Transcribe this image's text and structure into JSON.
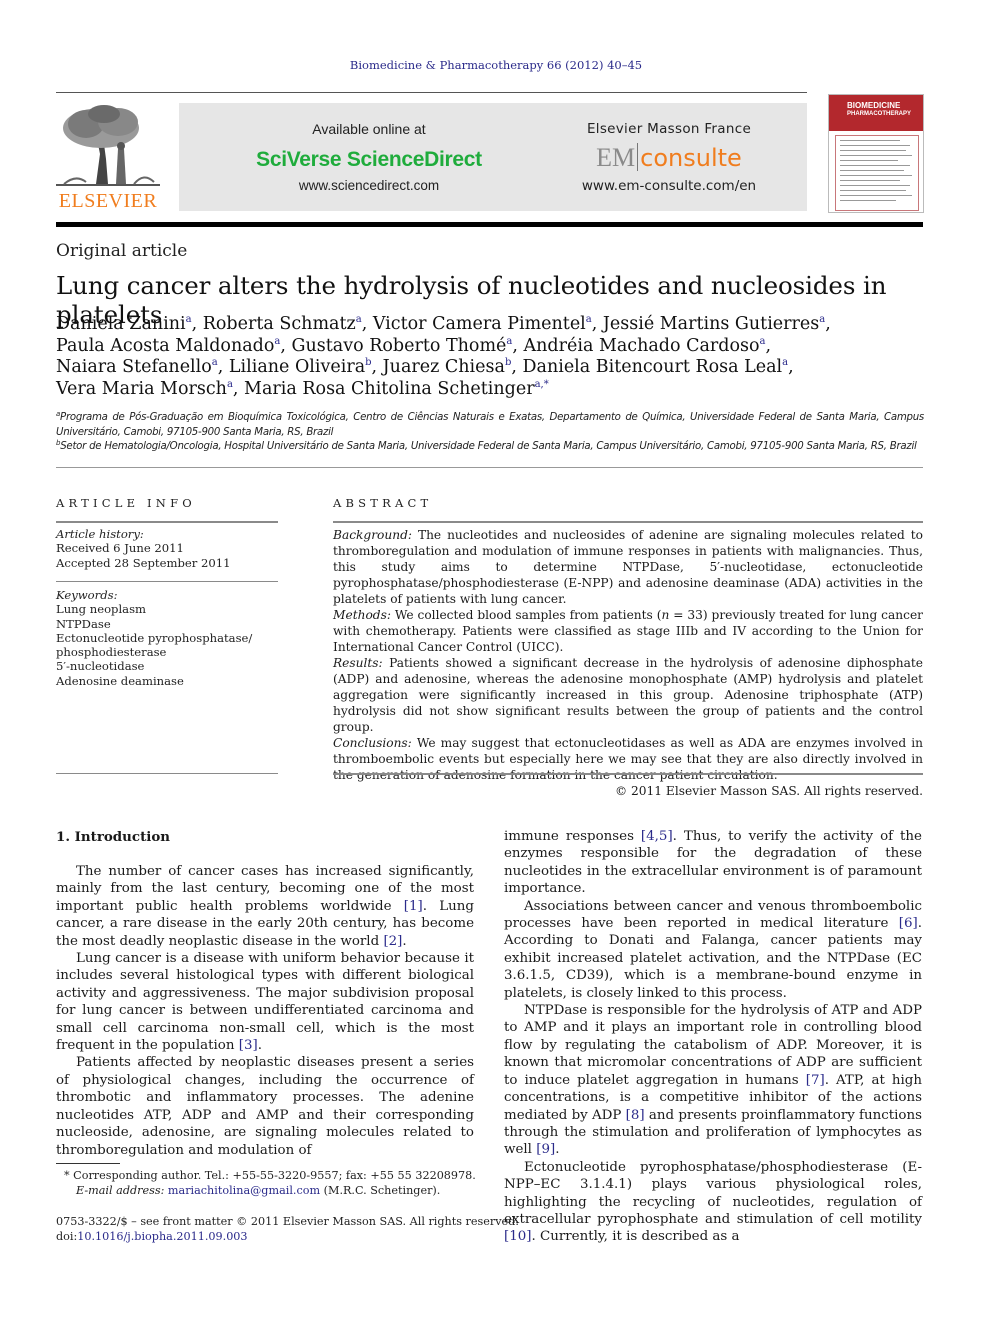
{
  "journal_ref": "Biomedicine & Pharmacotherapy 66 (2012) 40–45",
  "publisher_logo": {
    "icon": "elsevier-tree-icon",
    "wordmark": "ELSEVIER"
  },
  "banner": {
    "left": {
      "available": "Available online at",
      "brand": "SciVerse ScienceDirect",
      "url": "www.sciencedirect.com"
    },
    "right": {
      "publisher": "Elsevier Masson France",
      "logo_em": "EM",
      "logo_consulte": "consulte",
      "url": "www.em-consulte.com/en"
    },
    "brand_color": "#1fac3c",
    "accent_color": "#f07d1e"
  },
  "cover": {
    "title_line1": "BIOMEDICINE",
    "title_line2": "PHARMACOTHERAPY",
    "color": "#b3282d"
  },
  "article_type": "Original article",
  "title": "Lung cancer alters the hydrolysis of nucleotides and nucleosides in platelets",
  "authors": [
    {
      "name": "Daniela Zanini",
      "aff": "a",
      "sep": ", "
    },
    {
      "name": "Roberta Schmatz",
      "aff": "a",
      "sep": ", "
    },
    {
      "name": "Victor Camera Pimentel",
      "aff": "a",
      "sep": ", "
    },
    {
      "name": "Jessié Martins Gutierres",
      "aff": "a",
      "sep": ","
    },
    {
      "name": "Paula Acosta Maldonado",
      "aff": "a",
      "sep": ", "
    },
    {
      "name": "Gustavo Roberto Thomé",
      "aff": "a",
      "sep": ", "
    },
    {
      "name": "Andréia Machado Cardoso",
      "aff": "a",
      "sep": ","
    },
    {
      "name": "Naiara Stefanello",
      "aff": "a",
      "sep": ", "
    },
    {
      "name": "Liliane Oliveira",
      "aff": "b",
      "sep": ", "
    },
    {
      "name": "Juarez Chiesa",
      "aff": "b",
      "sep": ", "
    },
    {
      "name": "Daniela Bitencourt Rosa Leal",
      "aff": "a",
      "sep": ","
    },
    {
      "name": "Vera Maria Morsch",
      "aff": "a",
      "sep": ", "
    },
    {
      "name": "Maria Rosa Chitolina Schetinger",
      "aff": "a,*",
      "sep": ""
    }
  ],
  "affiliations": [
    {
      "label": "a",
      "text": "Programa de Pós-Graduação em Bioquímica Toxicológica, Centro de Ciências Naturais e Exatas, Departamento de Química, Universidade Federal de Santa Maria, Campus Universitário, Camobi, 97105-900 Santa Maria, RS, Brazil"
    },
    {
      "label": "b",
      "text": "Setor de Hematologia/Oncologia, Hospital Universitário de Santa Maria, Universidade Federal de Santa Maria, Campus Universitário, Camobi, 97105-900 Santa Maria, RS, Brazil"
    }
  ],
  "article_info": {
    "heading": "ARTICLE INFO",
    "history_label": "Article history:",
    "received": "Received 6 June 2011",
    "accepted": "Accepted 28 September 2011",
    "keywords_label": "Keywords:",
    "keywords": [
      "Lung neoplasm",
      "NTPDase",
      "Ectonucleotide pyrophosphatase/",
      "phosphodiesterase",
      "5′-nucleotidase",
      "Adenosine deaminase"
    ]
  },
  "abstract": {
    "heading": "ABSTRACT",
    "background_label": "Background:",
    "background": " The nucleotides and nucleosides of adenine are signaling molecules related to thromboregulation and modulation of immune responses in patients with malignancies. Thus, this study aims to determine NTPDase, 5′-nucleotidase, ectonucleotide pyrophosphatase/phosphodiesterase (E-NPP) and adenosine deaminase (ADA) activities in the platelets of patients with lung cancer.",
    "methods_label": "Methods:",
    "methods_pre": " We collected blood samples from patients (",
    "methods_n": "n",
    "methods_post": " = 33) previously treated for lung cancer with chemotherapy. Patients were classified as stage IIIb and IV according to the Union for International Cancer Control (UICC).",
    "results_label": "Results:",
    "results": " Patients showed a significant decrease in the hydrolysis of adenosine diphosphate (ADP) and adenosine, whereas the adenosine monophosphate (AMP) hydrolysis and platelet aggregation were significantly increased in this group. Adenosine triphosphate (ATP) hydrolysis did not show significant results between the group of patients and the control group.",
    "conclusions_label": "Conclusions:",
    "conclusions": " We may suggest that ectonucleotidases as well as ADA are enzymes involved in thromboembolic events but especially here we may see that they are also directly involved in the generation of adenosine formation in the cancer patient circulation.",
    "copyright": "© 2011 Elsevier Masson SAS. All rights reserved."
  },
  "intro": {
    "heading": "1.  Introduction",
    "left_paragraphs": [
      [
        {
          "t": "The number of cancer cases has increased significantly, mainly from the last century, becoming one of the most important public health problems worldwide "
        },
        {
          "t": "[1]",
          "ref": true
        },
        {
          "t": ". Lung cancer, a rare disease in the early 20th century, has become the most deadly neoplastic disease in the world "
        },
        {
          "t": "[2]",
          "ref": true
        },
        {
          "t": "."
        }
      ],
      [
        {
          "t": "Lung cancer is a disease with uniform behavior because it includes several histological types with different biological activity and aggressiveness. The major subdivision proposal for lung cancer is between undifferentiated carcinoma and small cell carcinoma non-small cell, which is the most frequent in the population "
        },
        {
          "t": "[3]",
          "ref": true
        },
        {
          "t": "."
        }
      ],
      [
        {
          "t": "Patients affected by neoplastic diseases present a series of physiological changes, including the occurrence of thrombotic and inflammatory processes. The adenine nucleotides ATP, ADP and AMP and their corresponding nucleoside, adenosine, are signaling molecules related to thromboregulation and modulation of"
        }
      ]
    ],
    "right_paragraphs": [
      [
        {
          "t": "immune responses "
        },
        {
          "t": "[4,5]",
          "ref": true
        },
        {
          "t": ". Thus, to verify the activity of the enzymes responsible for the degradation of these nucleotides in the extracellular environment is of paramount importance."
        }
      ],
      [
        {
          "t": "Associations between cancer and venous thromboembolic processes have been reported in medical literature "
        },
        {
          "t": "[6]",
          "ref": true
        },
        {
          "t": ". According to Donati and Falanga, cancer patients may exhibit increased platelet activation, and the NTPDase (EC 3.6.1.5, CD39), which is a membrane-bound enzyme in platelets, is closely linked to this process."
        }
      ],
      [
        {
          "t": "NTPDase is responsible for the hydrolysis of ATP and ADP to AMP and it plays an important role in controlling blood flow by regulating the catabolism of ADP. Moreover, it is known that micromolar concentrations of ADP are sufficient to induce platelet aggregation in humans "
        },
        {
          "t": "[7]",
          "ref": true
        },
        {
          "t": ". ATP, at high concentrations, is a competitive inhibitor of the actions mediated by ADP "
        },
        {
          "t": "[8]",
          "ref": true
        },
        {
          "t": " and presents proinflammatory functions through the stimulation and proliferation of lymphocytes as well "
        },
        {
          "t": "[9]",
          "ref": true
        },
        {
          "t": "."
        }
      ],
      [
        {
          "t": "Ectonucleotide pyrophosphatase/phosphodiesterase (E-NPP–EC 3.1.4.1) plays various physiological roles, highlighting the recycling of nucleotides, regulation of extracellular pyrophosphate and stimulation of cell motility "
        },
        {
          "t": "[10]",
          "ref": true
        },
        {
          "t": ". Currently, it is described as a"
        }
      ]
    ]
  },
  "footnote": {
    "star": "*",
    "corresponding": " Corresponding author. Tel.: +55-55-3220-9557; fax: +55 55 32208978.",
    "email_label": "E-mail address:",
    "email": "mariachitolina@gmail.com",
    "email_suffix": " (M.R.C. Schetinger)."
  },
  "front_matter": {
    "issn_line": "0753-3322/$ – see front matter © 2011 Elsevier Masson SAS. All rights reserved.",
    "doi_prefix": "doi:",
    "doi": "10.1016/j.biopha.2011.09.003"
  }
}
